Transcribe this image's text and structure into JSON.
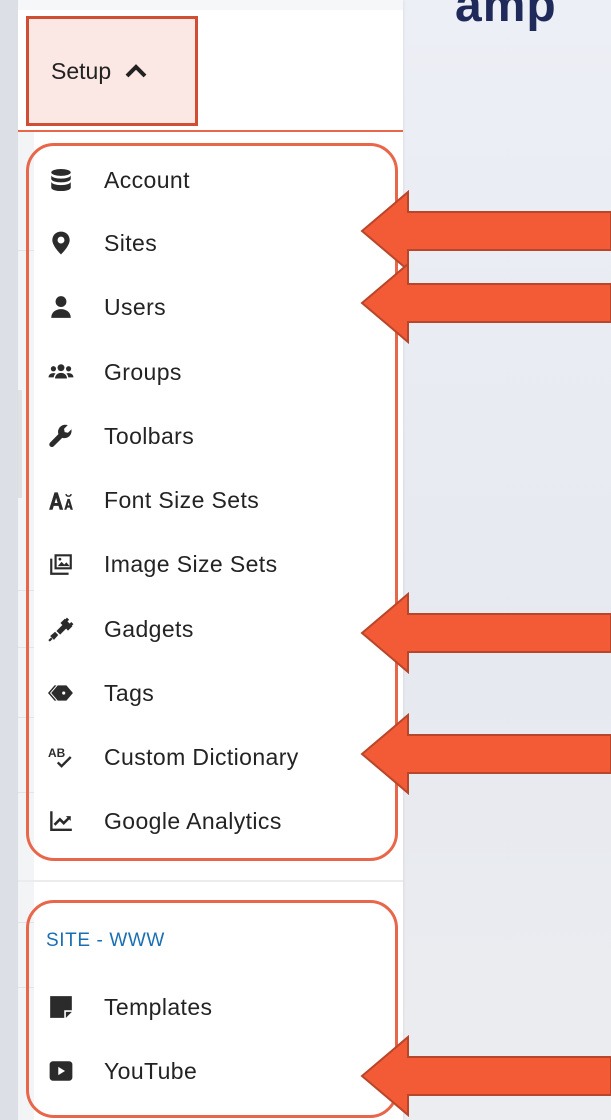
{
  "page": {
    "heading_fragment": "amp"
  },
  "setup_menu": {
    "label": "Setup",
    "expanded": true
  },
  "global_items": [
    {
      "label": "Account",
      "icon": "database-icon"
    },
    {
      "label": "Sites",
      "icon": "map-pin-icon"
    },
    {
      "label": "Users",
      "icon": "user-icon"
    },
    {
      "label": "Groups",
      "icon": "users-group-icon"
    },
    {
      "label": "Toolbars",
      "icon": "wrench-icon"
    },
    {
      "label": "Font Size Sets",
      "icon": "font-size-icon"
    },
    {
      "label": "Image Size Sets",
      "icon": "image-icon"
    },
    {
      "label": "Gadgets",
      "icon": "plug-icon"
    },
    {
      "label": "Tags",
      "icon": "tags-icon"
    },
    {
      "label": "Custom Dictionary",
      "icon": "spellcheck-icon"
    },
    {
      "label": "Google Analytics",
      "icon": "analytics-chart-icon"
    }
  ],
  "site_section": {
    "label": "SITE - WWW",
    "items": [
      {
        "label": "Templates",
        "icon": "sticky-note-icon"
      },
      {
        "label": "YouTube",
        "icon": "youtube-icon"
      }
    ]
  },
  "colors": {
    "highlight": "#e8664a",
    "arrow_fill": "#f35a36",
    "arrow_stroke": "#b8462a",
    "section_label": "#1a6fb3",
    "heading": "#1f2a5a"
  }
}
